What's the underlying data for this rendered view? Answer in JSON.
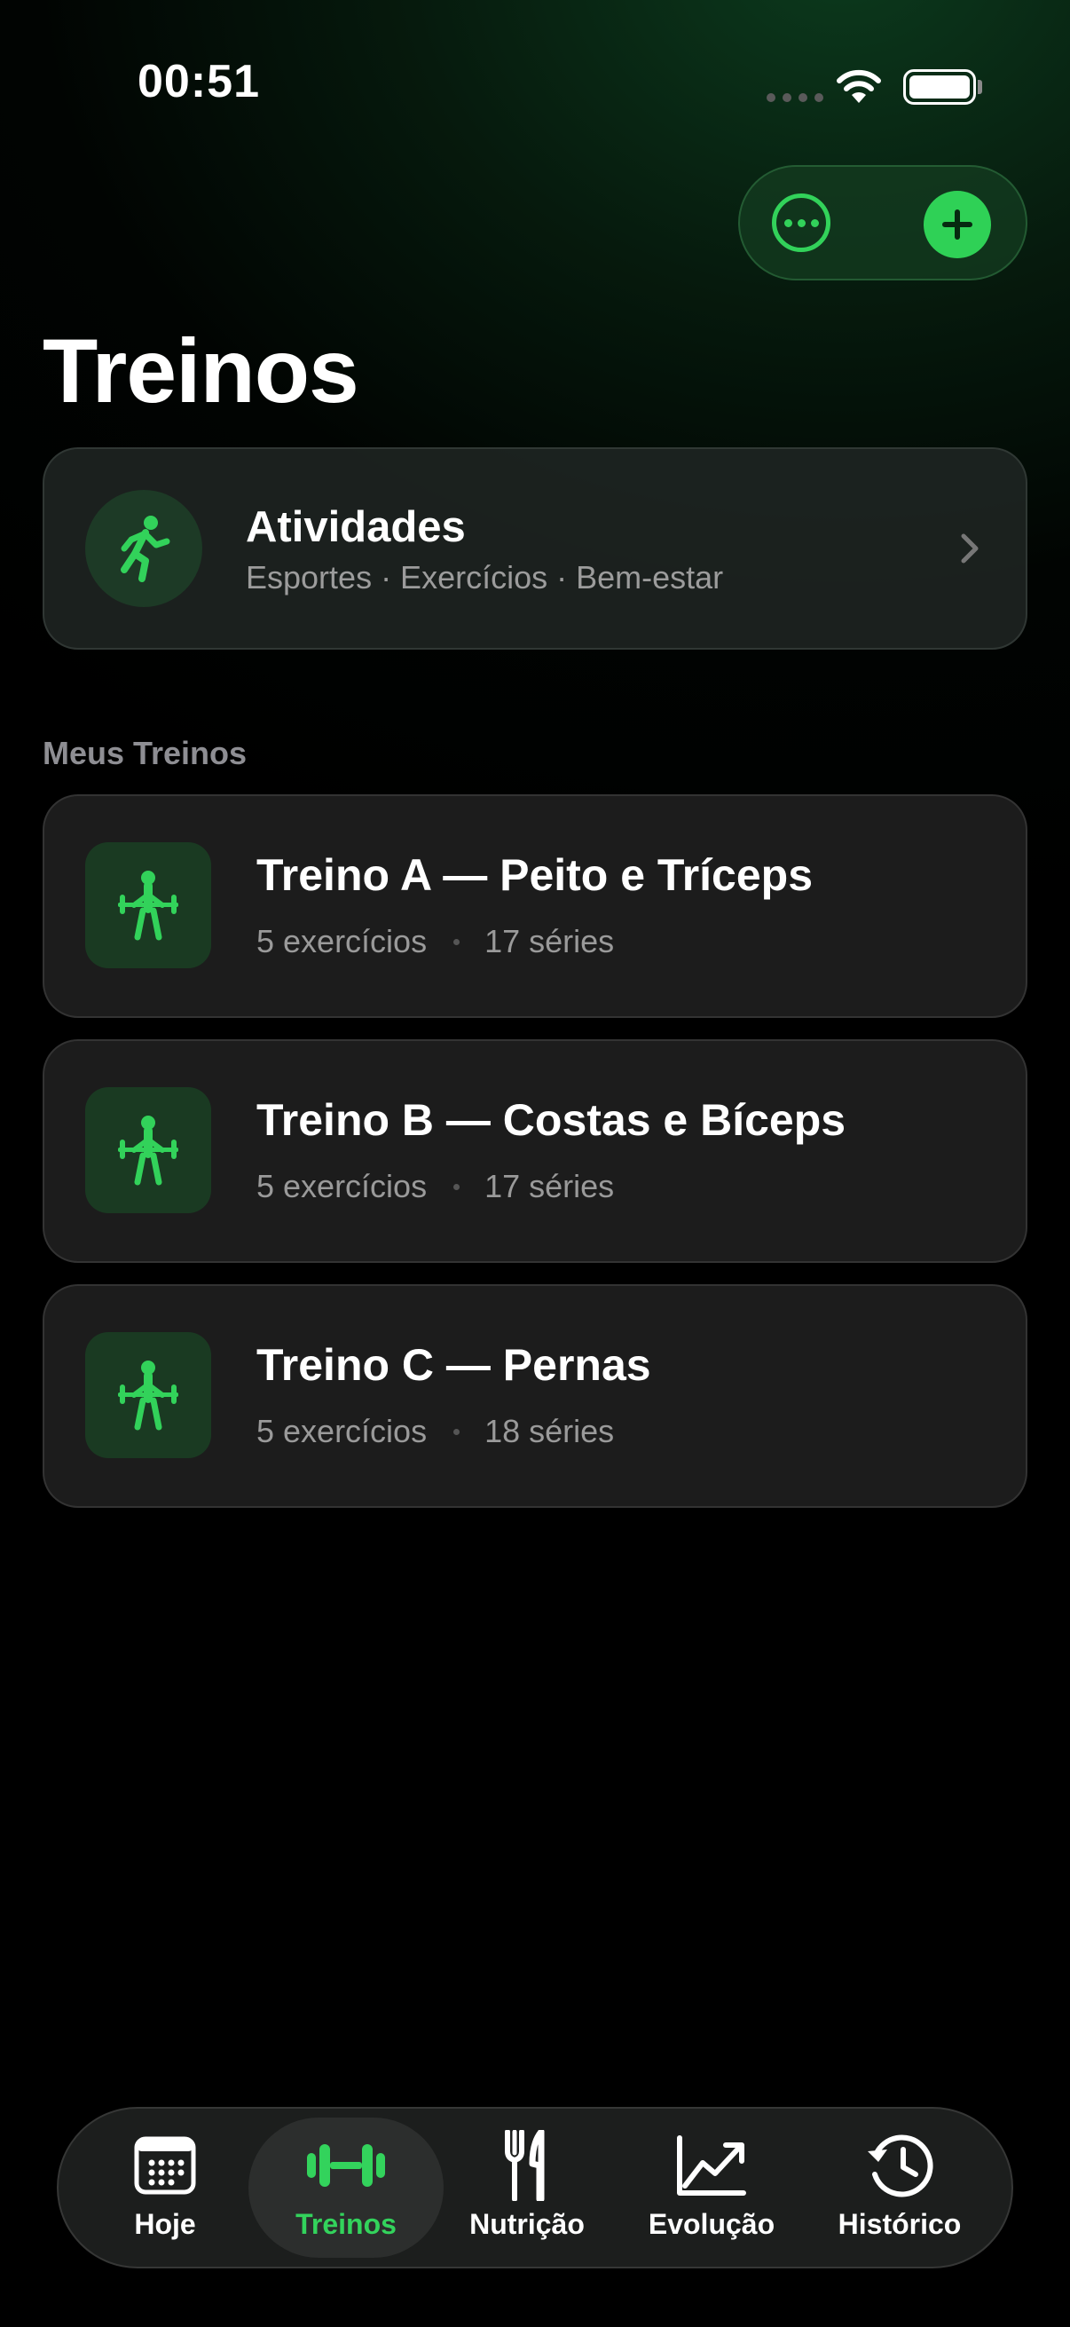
{
  "status_bar": {
    "time": "00:51"
  },
  "page": {
    "title": "Treinos"
  },
  "activities": {
    "title": "Atividades",
    "subtitle": "Esportes · Exercícios · Bem-estar"
  },
  "section": {
    "title": "Meus Treinos"
  },
  "workouts": [
    {
      "name": "Treino A — Peito e Tríceps",
      "exercises": "5 exercícios",
      "sets": "17 séries"
    },
    {
      "name": "Treino B — Costas e Bíceps",
      "exercises": "5 exercícios",
      "sets": "17 séries"
    },
    {
      "name": "Treino C — Pernas",
      "exercises": "5 exercícios",
      "sets": "18 séries"
    }
  ],
  "tabs": [
    {
      "label": "Hoje",
      "icon": "calendar-icon",
      "active": false
    },
    {
      "label": "Treinos",
      "icon": "dumbbell-icon",
      "active": true
    },
    {
      "label": "Nutrição",
      "icon": "fork-knife-icon",
      "active": false
    },
    {
      "label": "Evolução",
      "icon": "chart-up-icon",
      "active": false
    },
    {
      "label": "Histórico",
      "icon": "history-clock-icon",
      "active": false
    }
  ],
  "colors": {
    "accent": "#32d25a",
    "accent_dark_bg": "#1a3a22",
    "card_bg": "#1e1e1e",
    "secondary_text": "#9a9a9a"
  }
}
